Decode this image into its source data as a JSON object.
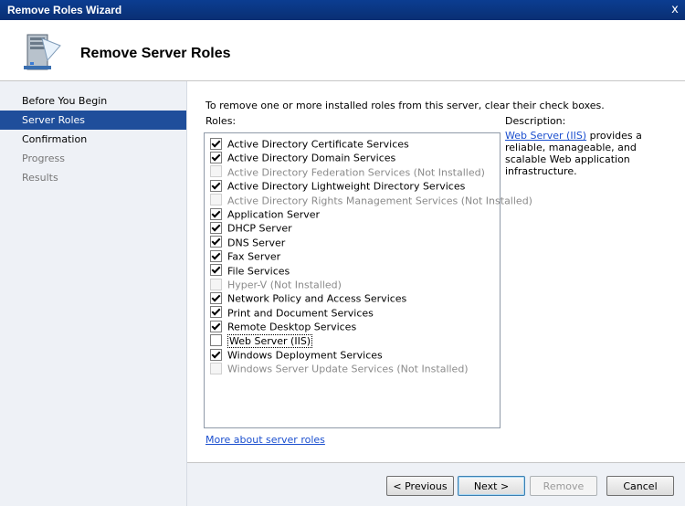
{
  "window": {
    "title": "Remove Roles Wizard",
    "close_glyph": "x"
  },
  "header": {
    "title": "Remove Server Roles",
    "icon": "server-remove-icon"
  },
  "nav": {
    "items": [
      {
        "label": "Before You Begin",
        "state": "normal"
      },
      {
        "label": "Server Roles",
        "state": "active"
      },
      {
        "label": "Confirmation",
        "state": "normal"
      },
      {
        "label": "Progress",
        "state": "disabled"
      },
      {
        "label": "Results",
        "state": "normal"
      }
    ]
  },
  "content": {
    "instruction": "To remove one or more installed roles from this server, clear their check boxes.",
    "roles_label": "Roles:",
    "description_label": "Description:",
    "roles": [
      {
        "label": "Active Directory Certificate Services",
        "checked": true,
        "disabled": false
      },
      {
        "label": "Active Directory Domain Services",
        "checked": true,
        "disabled": false
      },
      {
        "label": "Active Directory Federation Services  (Not Installed)",
        "checked": false,
        "disabled": true
      },
      {
        "label": "Active Directory Lightweight Directory Services",
        "checked": true,
        "disabled": false
      },
      {
        "label": "Active Directory Rights Management Services  (Not Installed)",
        "checked": false,
        "disabled": true
      },
      {
        "label": "Application Server",
        "checked": true,
        "disabled": false
      },
      {
        "label": "DHCP Server",
        "checked": true,
        "disabled": false
      },
      {
        "label": "DNS Server",
        "checked": true,
        "disabled": false
      },
      {
        "label": "Fax Server",
        "checked": true,
        "disabled": false
      },
      {
        "label": "File Services",
        "checked": true,
        "disabled": false
      },
      {
        "label": "Hyper-V  (Not Installed)",
        "checked": false,
        "disabled": true
      },
      {
        "label": "Network Policy and Access Services",
        "checked": true,
        "disabled": false
      },
      {
        "label": "Print and Document Services",
        "checked": true,
        "disabled": false
      },
      {
        "label": "Remote Desktop Services",
        "checked": true,
        "disabled": false
      },
      {
        "label": "Web Server (IIS)",
        "checked": false,
        "disabled": false,
        "selected": true
      },
      {
        "label": "Windows Deployment Services",
        "checked": true,
        "disabled": false
      },
      {
        "label": "Windows Server Update Services  (Not Installed)",
        "checked": false,
        "disabled": true
      }
    ],
    "description": {
      "link": "Web Server (IIS)",
      "text": " provides a reliable, manageable, and scalable Web application infrastructure."
    },
    "more_link": "More about server roles"
  },
  "buttons": {
    "previous": "< Previous",
    "next": "Next >",
    "remove": "Remove",
    "cancel": "Cancel"
  }
}
